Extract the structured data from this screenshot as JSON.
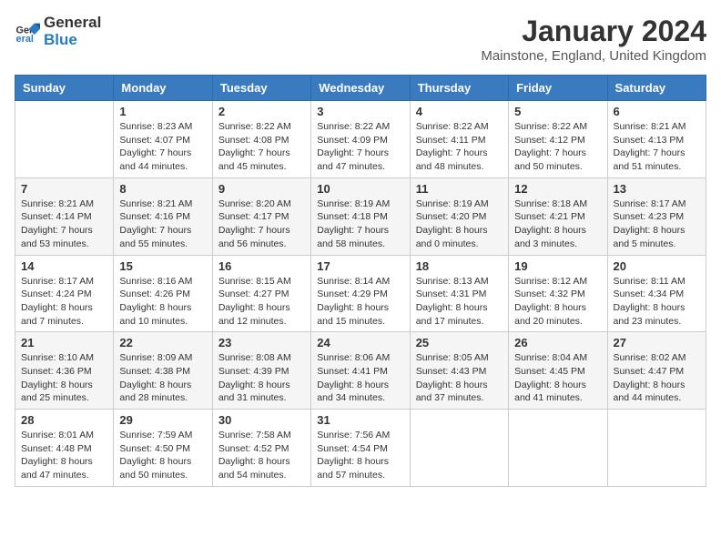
{
  "logo": {
    "general": "General",
    "blue": "Blue"
  },
  "header": {
    "title": "January 2024",
    "subtitle": "Mainstone, England, United Kingdom"
  },
  "weekdays": [
    "Sunday",
    "Monday",
    "Tuesday",
    "Wednesday",
    "Thursday",
    "Friday",
    "Saturday"
  ],
  "weeks": [
    [
      {
        "day": "",
        "sunrise": "",
        "sunset": "",
        "daylight": ""
      },
      {
        "day": "1",
        "sunrise": "Sunrise: 8:23 AM",
        "sunset": "Sunset: 4:07 PM",
        "daylight": "Daylight: 7 hours and 44 minutes."
      },
      {
        "day": "2",
        "sunrise": "Sunrise: 8:22 AM",
        "sunset": "Sunset: 4:08 PM",
        "daylight": "Daylight: 7 hours and 45 minutes."
      },
      {
        "day": "3",
        "sunrise": "Sunrise: 8:22 AM",
        "sunset": "Sunset: 4:09 PM",
        "daylight": "Daylight: 7 hours and 47 minutes."
      },
      {
        "day": "4",
        "sunrise": "Sunrise: 8:22 AM",
        "sunset": "Sunset: 4:11 PM",
        "daylight": "Daylight: 7 hours and 48 minutes."
      },
      {
        "day": "5",
        "sunrise": "Sunrise: 8:22 AM",
        "sunset": "Sunset: 4:12 PM",
        "daylight": "Daylight: 7 hours and 50 minutes."
      },
      {
        "day": "6",
        "sunrise": "Sunrise: 8:21 AM",
        "sunset": "Sunset: 4:13 PM",
        "daylight": "Daylight: 7 hours and 51 minutes."
      }
    ],
    [
      {
        "day": "7",
        "sunrise": "Sunrise: 8:21 AM",
        "sunset": "Sunset: 4:14 PM",
        "daylight": "Daylight: 7 hours and 53 minutes."
      },
      {
        "day": "8",
        "sunrise": "Sunrise: 8:21 AM",
        "sunset": "Sunset: 4:16 PM",
        "daylight": "Daylight: 7 hours and 55 minutes."
      },
      {
        "day": "9",
        "sunrise": "Sunrise: 8:20 AM",
        "sunset": "Sunset: 4:17 PM",
        "daylight": "Daylight: 7 hours and 56 minutes."
      },
      {
        "day": "10",
        "sunrise": "Sunrise: 8:19 AM",
        "sunset": "Sunset: 4:18 PM",
        "daylight": "Daylight: 7 hours and 58 minutes."
      },
      {
        "day": "11",
        "sunrise": "Sunrise: 8:19 AM",
        "sunset": "Sunset: 4:20 PM",
        "daylight": "Daylight: 8 hours and 0 minutes."
      },
      {
        "day": "12",
        "sunrise": "Sunrise: 8:18 AM",
        "sunset": "Sunset: 4:21 PM",
        "daylight": "Daylight: 8 hours and 3 minutes."
      },
      {
        "day": "13",
        "sunrise": "Sunrise: 8:17 AM",
        "sunset": "Sunset: 4:23 PM",
        "daylight": "Daylight: 8 hours and 5 minutes."
      }
    ],
    [
      {
        "day": "14",
        "sunrise": "Sunrise: 8:17 AM",
        "sunset": "Sunset: 4:24 PM",
        "daylight": "Daylight: 8 hours and 7 minutes."
      },
      {
        "day": "15",
        "sunrise": "Sunrise: 8:16 AM",
        "sunset": "Sunset: 4:26 PM",
        "daylight": "Daylight: 8 hours and 10 minutes."
      },
      {
        "day": "16",
        "sunrise": "Sunrise: 8:15 AM",
        "sunset": "Sunset: 4:27 PM",
        "daylight": "Daylight: 8 hours and 12 minutes."
      },
      {
        "day": "17",
        "sunrise": "Sunrise: 8:14 AM",
        "sunset": "Sunset: 4:29 PM",
        "daylight": "Daylight: 8 hours and 15 minutes."
      },
      {
        "day": "18",
        "sunrise": "Sunrise: 8:13 AM",
        "sunset": "Sunset: 4:31 PM",
        "daylight": "Daylight: 8 hours and 17 minutes."
      },
      {
        "day": "19",
        "sunrise": "Sunrise: 8:12 AM",
        "sunset": "Sunset: 4:32 PM",
        "daylight": "Daylight: 8 hours and 20 minutes."
      },
      {
        "day": "20",
        "sunrise": "Sunrise: 8:11 AM",
        "sunset": "Sunset: 4:34 PM",
        "daylight": "Daylight: 8 hours and 23 minutes."
      }
    ],
    [
      {
        "day": "21",
        "sunrise": "Sunrise: 8:10 AM",
        "sunset": "Sunset: 4:36 PM",
        "daylight": "Daylight: 8 hours and 25 minutes."
      },
      {
        "day": "22",
        "sunrise": "Sunrise: 8:09 AM",
        "sunset": "Sunset: 4:38 PM",
        "daylight": "Daylight: 8 hours and 28 minutes."
      },
      {
        "day": "23",
        "sunrise": "Sunrise: 8:08 AM",
        "sunset": "Sunset: 4:39 PM",
        "daylight": "Daylight: 8 hours and 31 minutes."
      },
      {
        "day": "24",
        "sunrise": "Sunrise: 8:06 AM",
        "sunset": "Sunset: 4:41 PM",
        "daylight": "Daylight: 8 hours and 34 minutes."
      },
      {
        "day": "25",
        "sunrise": "Sunrise: 8:05 AM",
        "sunset": "Sunset: 4:43 PM",
        "daylight": "Daylight: 8 hours and 37 minutes."
      },
      {
        "day": "26",
        "sunrise": "Sunrise: 8:04 AM",
        "sunset": "Sunset: 4:45 PM",
        "daylight": "Daylight: 8 hours and 41 minutes."
      },
      {
        "day": "27",
        "sunrise": "Sunrise: 8:02 AM",
        "sunset": "Sunset: 4:47 PM",
        "daylight": "Daylight: 8 hours and 44 minutes."
      }
    ],
    [
      {
        "day": "28",
        "sunrise": "Sunrise: 8:01 AM",
        "sunset": "Sunset: 4:48 PM",
        "daylight": "Daylight: 8 hours and 47 minutes."
      },
      {
        "day": "29",
        "sunrise": "Sunrise: 7:59 AM",
        "sunset": "Sunset: 4:50 PM",
        "daylight": "Daylight: 8 hours and 50 minutes."
      },
      {
        "day": "30",
        "sunrise": "Sunrise: 7:58 AM",
        "sunset": "Sunset: 4:52 PM",
        "daylight": "Daylight: 8 hours and 54 minutes."
      },
      {
        "day": "31",
        "sunrise": "Sunrise: 7:56 AM",
        "sunset": "Sunset: 4:54 PM",
        "daylight": "Daylight: 8 hours and 57 minutes."
      },
      {
        "day": "",
        "sunrise": "",
        "sunset": "",
        "daylight": ""
      },
      {
        "day": "",
        "sunrise": "",
        "sunset": "",
        "daylight": ""
      },
      {
        "day": "",
        "sunrise": "",
        "sunset": "",
        "daylight": ""
      }
    ]
  ]
}
